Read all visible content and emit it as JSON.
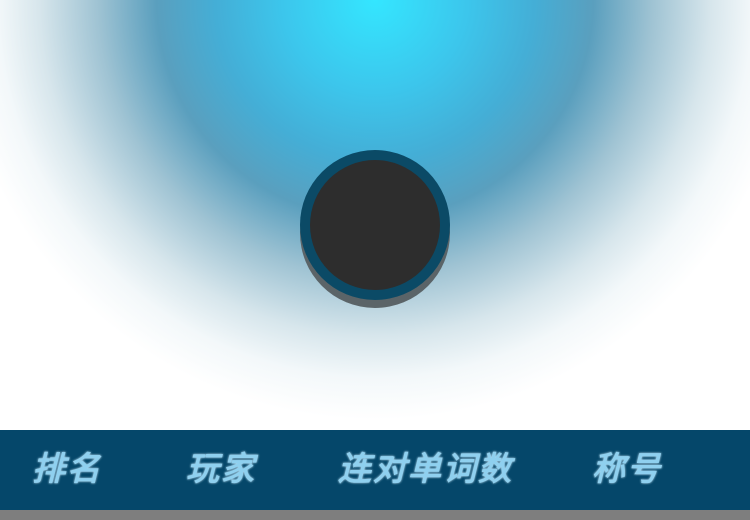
{
  "leaderboard": {
    "columns": {
      "rank": "排名",
      "player": "玩家",
      "streak_words": "连对单词数",
      "title": "称号"
    }
  },
  "colors": {
    "glow_center": "#34e6ff",
    "header_bg": "#05476a",
    "header_text": "#8fd0ef",
    "avatar_ring": "#0b4a66",
    "avatar_fill": "#2d2d2d"
  }
}
